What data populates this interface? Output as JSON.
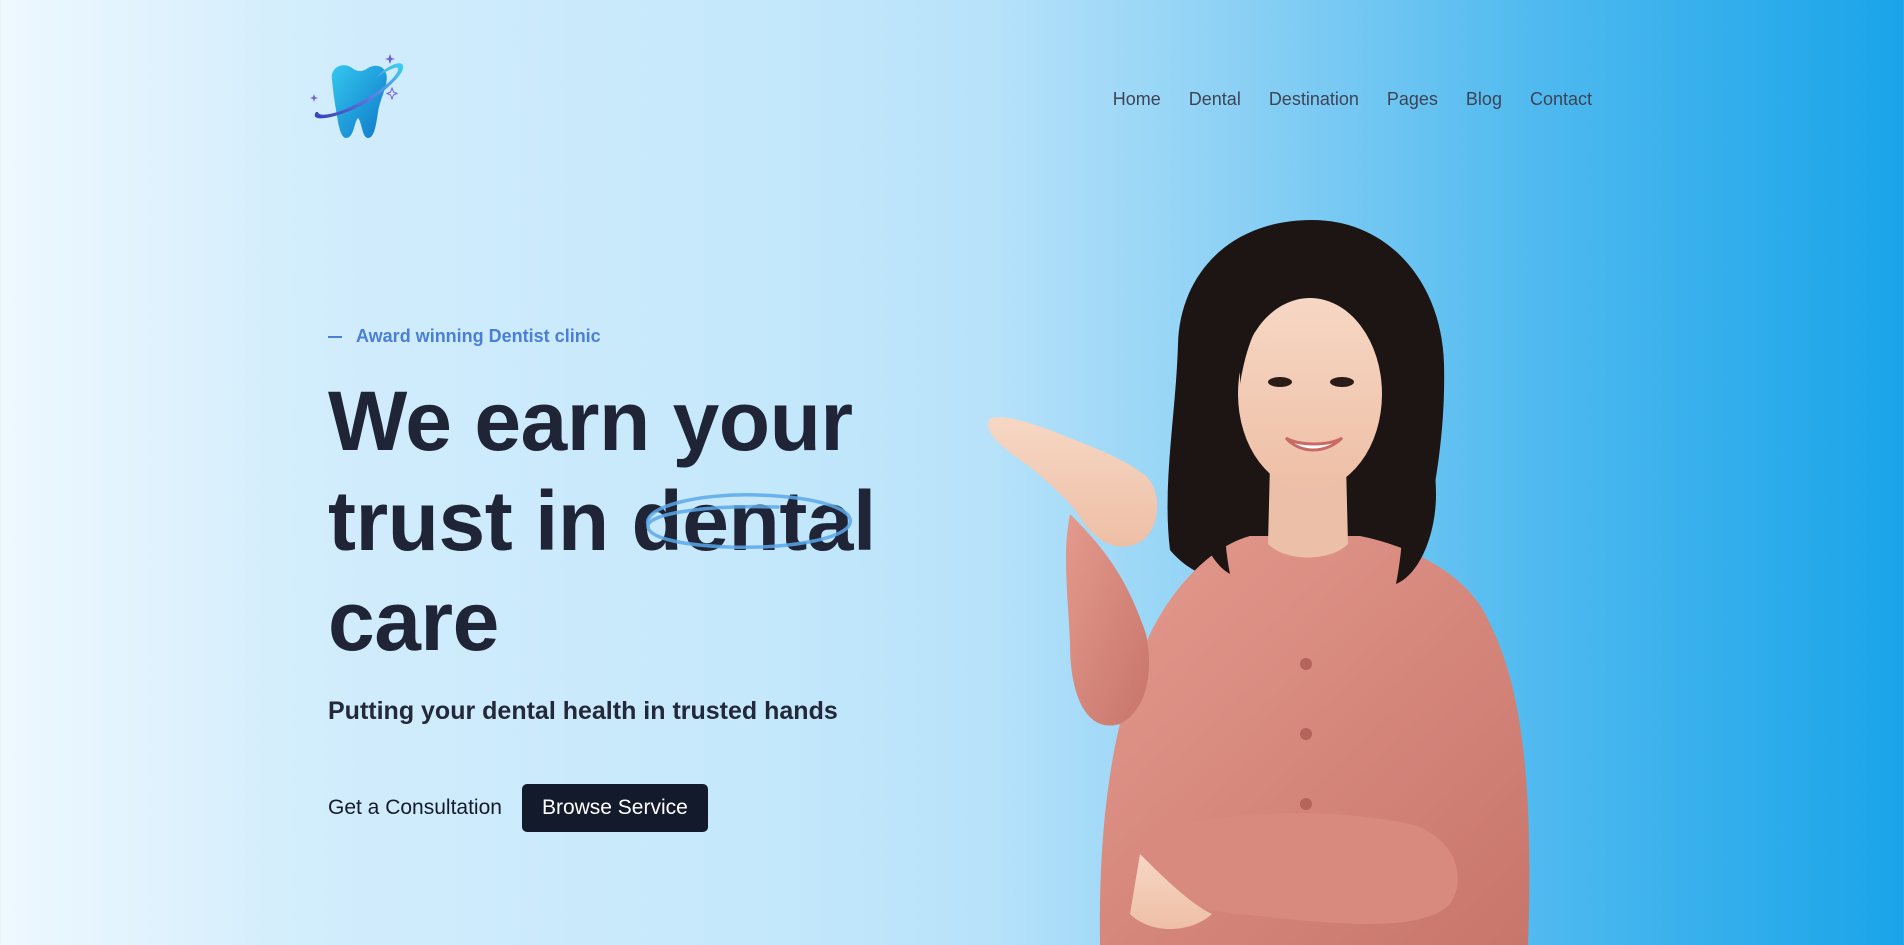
{
  "brand": {
    "logo_icon": "tooth-orbit-icon",
    "colors": {
      "primary": "#1aa4e9",
      "accent": "#4a7fd8",
      "dark": "#121a2c"
    }
  },
  "nav": {
    "items": [
      {
        "label": "Home"
      },
      {
        "label": "Dental"
      },
      {
        "label": "Destination"
      },
      {
        "label": "Pages"
      },
      {
        "label": "Blog"
      },
      {
        "label": "Contact"
      }
    ]
  },
  "hero": {
    "eyebrow": "Award winning Dentist clinic",
    "headline": {
      "line1": "We earn your",
      "line2_prefix": "trust in ",
      "line2_highlight": "dental",
      "line3": "care"
    },
    "subtitle": "Putting your dental health in trusted hands",
    "cta_secondary": "Get a Consultation",
    "cta_primary": "Browse Service"
  }
}
